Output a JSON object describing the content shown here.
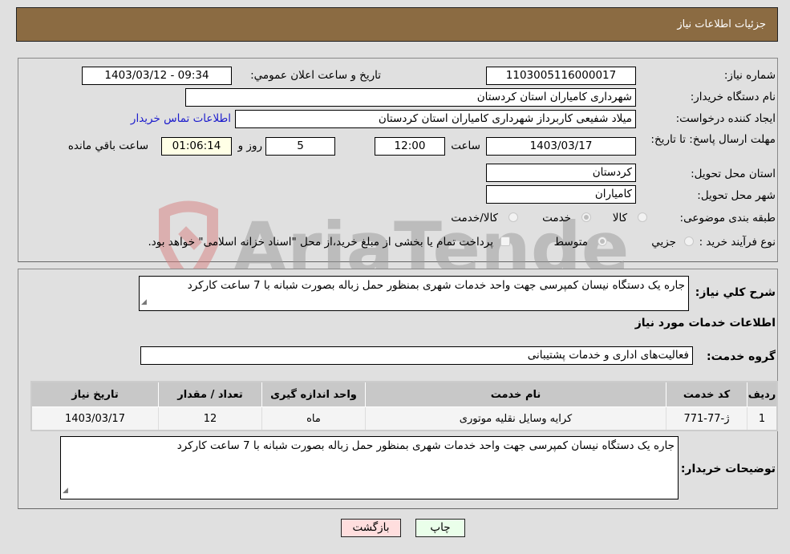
{
  "header": {
    "title": "جزئیات اطلاعات نیاز"
  },
  "details": {
    "need_number_label": "شماره نیاز:",
    "need_number": "1103005116000017",
    "announce_label": "تاریخ و ساعت اعلان عمومي:",
    "announce_value": "1403/03/12 - 09:34",
    "buyer_org_label": "نام دستگاه خریدار:",
    "buyer_org": "شهرداری کامیاران استان کردستان",
    "creator_label": "ایجاد کننده درخواست:",
    "creator": "میلاد شفیعی کاربرداز شهرداری کامیاران استان کردستان",
    "contact_link": "اطلاعات تماس خریدار",
    "deadline_label": "مهلت ارسال پاسخ: تا تاریخ:",
    "deadline_date": "1403/03/17",
    "time_label": "ساعت",
    "deadline_time": "12:00",
    "days_value": "5",
    "days_label": "روز و",
    "remaining_value": "01:06:14",
    "remaining_label": "ساعت باقي مانده",
    "province_label": "استان محل تحویل:",
    "province": "کردستان",
    "city_label": "شهر محل تحویل:",
    "city": "کامیاران",
    "category_label": "طبقه بندی موضوعی:",
    "category_options": [
      {
        "label": "کالا",
        "checked": false
      },
      {
        "label": "خدمت",
        "checked": true
      },
      {
        "label": "کالا/خدمت",
        "checked": false
      }
    ],
    "process_label": "نوع فرآیند خرید :",
    "process_options": [
      {
        "label": "جزيي",
        "checked": false
      },
      {
        "label": "متوسط",
        "checked": true
      }
    ],
    "treasury_note": "پرداخت تمام یا بخشی از مبلغ خرید،از محل \"اسناد خزانه اسلامی\" خواهد بود."
  },
  "description": {
    "label": "شرح کلي نياز:",
    "value": "جاره یک دستگاه نیسان کمپرسی جهت واحد خدمات شهری بمنظور حمل زباله بصورت شبانه با 7 ساعت کارکرد"
  },
  "services": {
    "section_title": "اطلاعات خدمات مورد نياز",
    "group_label": "گروه خدمت:",
    "group_value": "فعالیت‌های اداری و خدمات پشتیبانی",
    "columns": [
      "رديف",
      "کد خدمت",
      "نام خدمت",
      "واحد اندازه گيری",
      "تعداد / مقدار",
      "تاريخ نياز"
    ],
    "rows": [
      [
        "1",
        "ژ-77-771",
        "کرايه وسايل نقليه موتوری",
        "ماه",
        "12",
        "1403/03/17"
      ]
    ]
  },
  "buyer_notes": {
    "label": "توضیحات خریدار:",
    "value": "جاره یک دستگاه نیسان کمپرسی جهت واحد خدمات شهری بمنظور حمل زباله بصورت شبانه با 7 ساعت کارکرد"
  },
  "buttons": {
    "print": "چاپ",
    "back": "بازگشت"
  },
  "watermark": {
    "text": "AriaTender.neT"
  }
}
